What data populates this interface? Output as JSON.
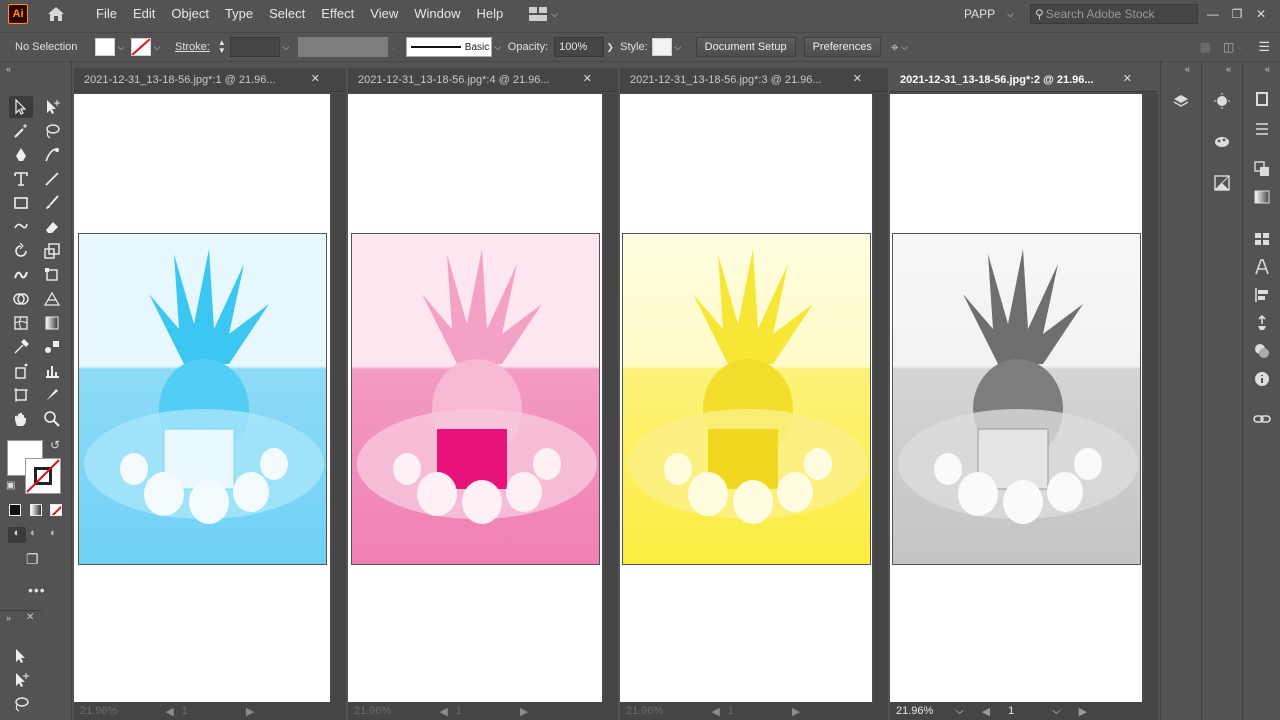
{
  "app": {
    "logo": "Ai",
    "menus": [
      "File",
      "Edit",
      "Object",
      "Type",
      "Select",
      "Effect",
      "View",
      "Window",
      "Help"
    ],
    "workspace": "PAPP",
    "search_placeholder": "Search Adobe Stock"
  },
  "control": {
    "selection": "No Selection",
    "stroke_label": "Stroke:",
    "brush": "Basic",
    "opacity_label": "Opacity:",
    "opacity": "100%",
    "style_label": "Style:",
    "doc_setup": "Document Setup",
    "prefs": "Preferences"
  },
  "docs": [
    {
      "title": "2021-12-31_13-18-56.jpg*:1 @ 21.96...",
      "zoom": "21.96%",
      "page": "1",
      "tint": "#3cc7f2",
      "active": false
    },
    {
      "title": "2021-12-31_13-18-56.jpg*:4 @ 21.96...",
      "zoom": "21.96%",
      "page": "1",
      "tint": "#f0569c",
      "active": false
    },
    {
      "title": "2021-12-31_13-18-56.jpg*:3 @ 21.96...",
      "zoom": "21.96%",
      "page": "1",
      "tint": "#fbec1e",
      "active": false
    },
    {
      "title": "2021-12-31_13-18-56.jpg*:2 @ 21.96...",
      "zoom": "21.96%",
      "page": "1",
      "tint": "#7a7a7a",
      "active": true
    }
  ],
  "colors": {
    "bg": "#535353",
    "canvas": "#ffffff",
    "accent_logo": "#ff9a00"
  }
}
